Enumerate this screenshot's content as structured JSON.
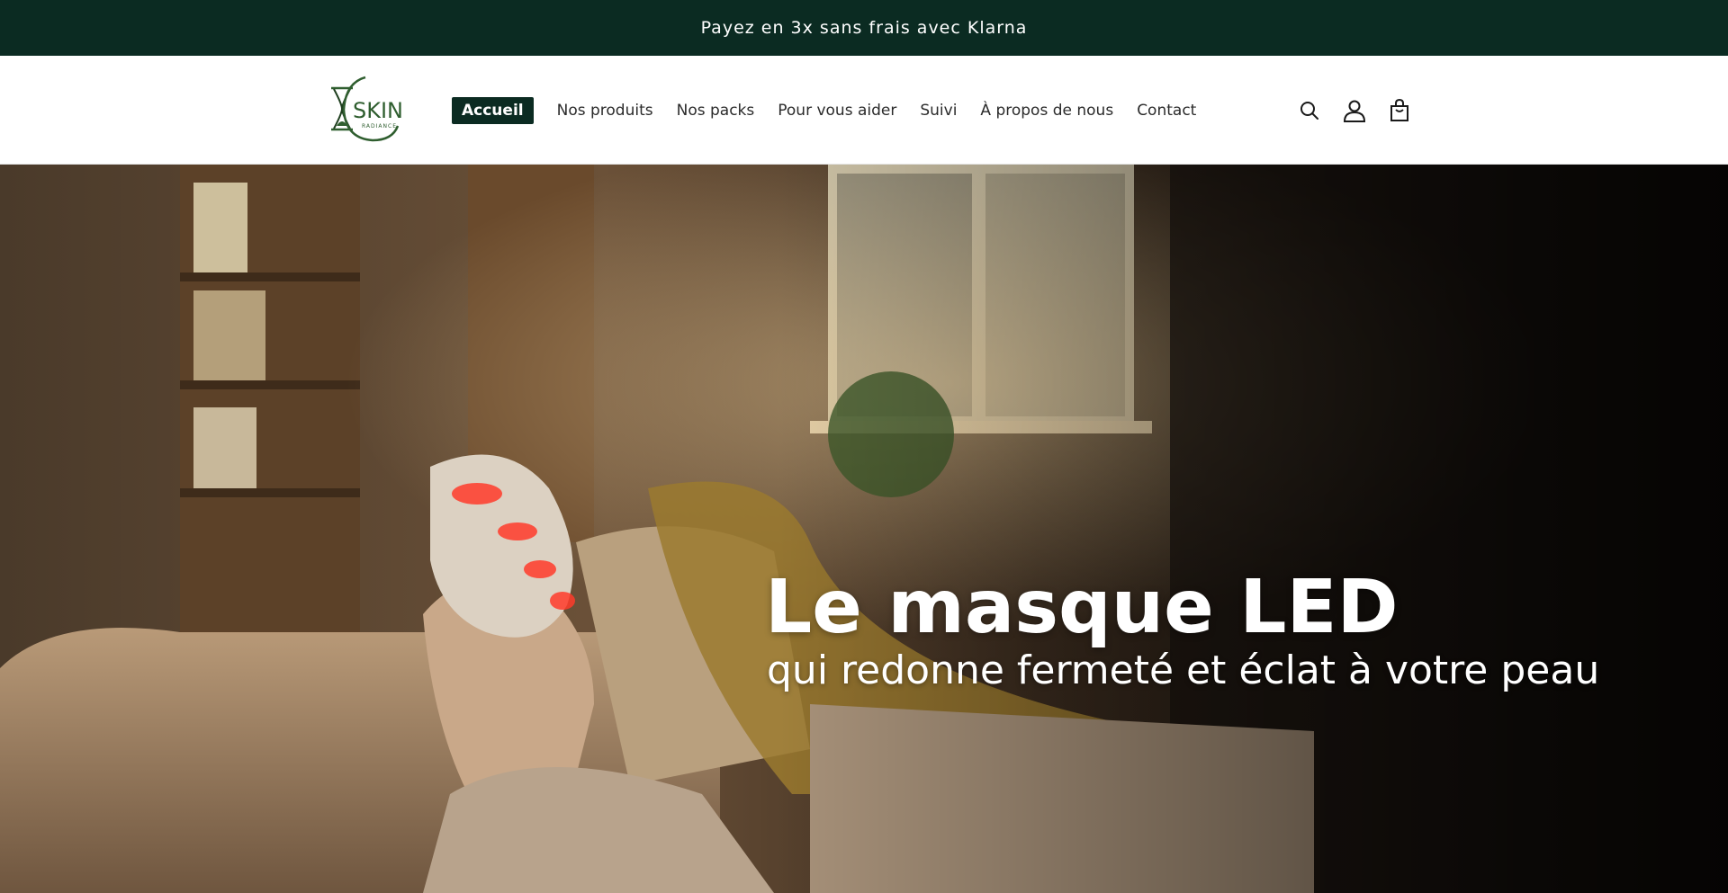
{
  "announcement": {
    "text": "Payez en 3x sans frais avec Klarna"
  },
  "brand": {
    "name": "SKIN",
    "tagline": "RADIANCE",
    "color": "#2f5e2f"
  },
  "nav": {
    "items": [
      {
        "label": "Accueil",
        "active": true
      },
      {
        "label": "Nos produits",
        "active": false
      },
      {
        "label": "Nos packs",
        "active": false
      },
      {
        "label": "Pour vous aider",
        "active": false
      },
      {
        "label": "Suivi",
        "active": false
      },
      {
        "label": "À propos de nous",
        "active": false
      },
      {
        "label": "Contact",
        "active": false
      }
    ]
  },
  "header_icons": [
    {
      "name": "search-icon"
    },
    {
      "name": "account-icon"
    },
    {
      "name": "cart-icon"
    }
  ],
  "hero": {
    "title": "Le masque LED",
    "subtitle": "qui redonne fermeté et éclat à votre peau"
  },
  "colors": {
    "announce_bg": "#0b2b22",
    "accent": "#0b2b22",
    "mask_glow": "#ff3b2a"
  }
}
